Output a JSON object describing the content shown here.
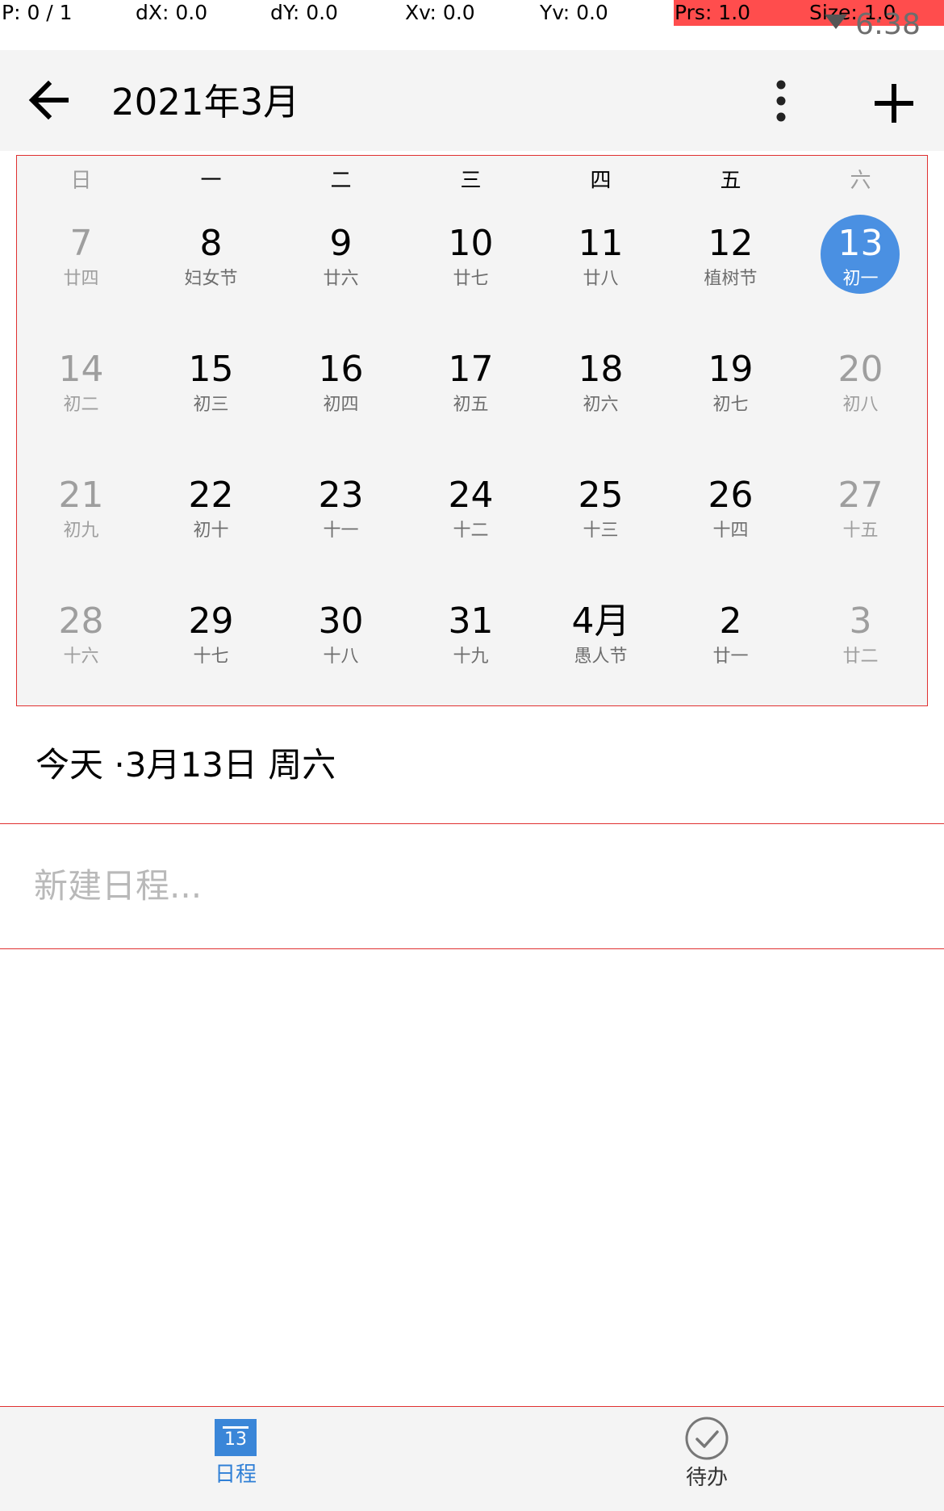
{
  "debug": {
    "p": "P: 0 / 1",
    "dx": "dX: 0.0",
    "dy": "dY: 0.0",
    "xv": "Xv: 0.0",
    "yv": "Yv: 0.0",
    "prs": "Prs: 1.0",
    "size": "Size: 1.0"
  },
  "status": {
    "time": "6:38"
  },
  "toolbar": {
    "title": "2021年3月",
    "back_icon": "arrow-left-icon",
    "more_icon": "more-vert-icon",
    "add_icon": "plus-icon"
  },
  "weekdays": [
    "日",
    "一",
    "二",
    "三",
    "四",
    "五",
    "六"
  ],
  "weeks": [
    [
      {
        "day": "7",
        "lunar": "廿四",
        "grey": true
      },
      {
        "day": "8",
        "lunar": "妇女节"
      },
      {
        "day": "9",
        "lunar": "廿六"
      },
      {
        "day": "10",
        "lunar": "廿七"
      },
      {
        "day": "11",
        "lunar": "廿八"
      },
      {
        "day": "12",
        "lunar": "植树节"
      },
      {
        "day": "13",
        "lunar": "初一",
        "selected": true
      }
    ],
    [
      {
        "day": "14",
        "lunar": "初二",
        "grey": true
      },
      {
        "day": "15",
        "lunar": "初三"
      },
      {
        "day": "16",
        "lunar": "初四"
      },
      {
        "day": "17",
        "lunar": "初五"
      },
      {
        "day": "18",
        "lunar": "初六"
      },
      {
        "day": "19",
        "lunar": "初七"
      },
      {
        "day": "20",
        "lunar": "初八",
        "grey": true
      }
    ],
    [
      {
        "day": "21",
        "lunar": "初九",
        "grey": true
      },
      {
        "day": "22",
        "lunar": "初十"
      },
      {
        "day": "23",
        "lunar": "十一"
      },
      {
        "day": "24",
        "lunar": "十二"
      },
      {
        "day": "25",
        "lunar": "十三"
      },
      {
        "day": "26",
        "lunar": "十四"
      },
      {
        "day": "27",
        "lunar": "十五",
        "grey": true
      }
    ],
    [
      {
        "day": "28",
        "lunar": "十六",
        "grey": true
      },
      {
        "day": "29",
        "lunar": "十七"
      },
      {
        "day": "30",
        "lunar": "十八"
      },
      {
        "day": "31",
        "lunar": "十九"
      },
      {
        "day": "4月",
        "lunar": "愚人节"
      },
      {
        "day": "2",
        "lunar": "廿一"
      },
      {
        "day": "3",
        "lunar": "廿二",
        "grey": true
      }
    ]
  ],
  "today_label": "今天 ·3月13日 周六",
  "new_event_placeholder": "新建日程...",
  "bottom_nav": {
    "schedule_label": "日程",
    "schedule_icon_day": "13",
    "todo_label": "待办",
    "todo_icon": "check-circle-icon"
  },
  "colors": {
    "accent": "#4a90e2",
    "nav_active": "#2f7fd6",
    "debug_red": "#ff4d4d"
  }
}
